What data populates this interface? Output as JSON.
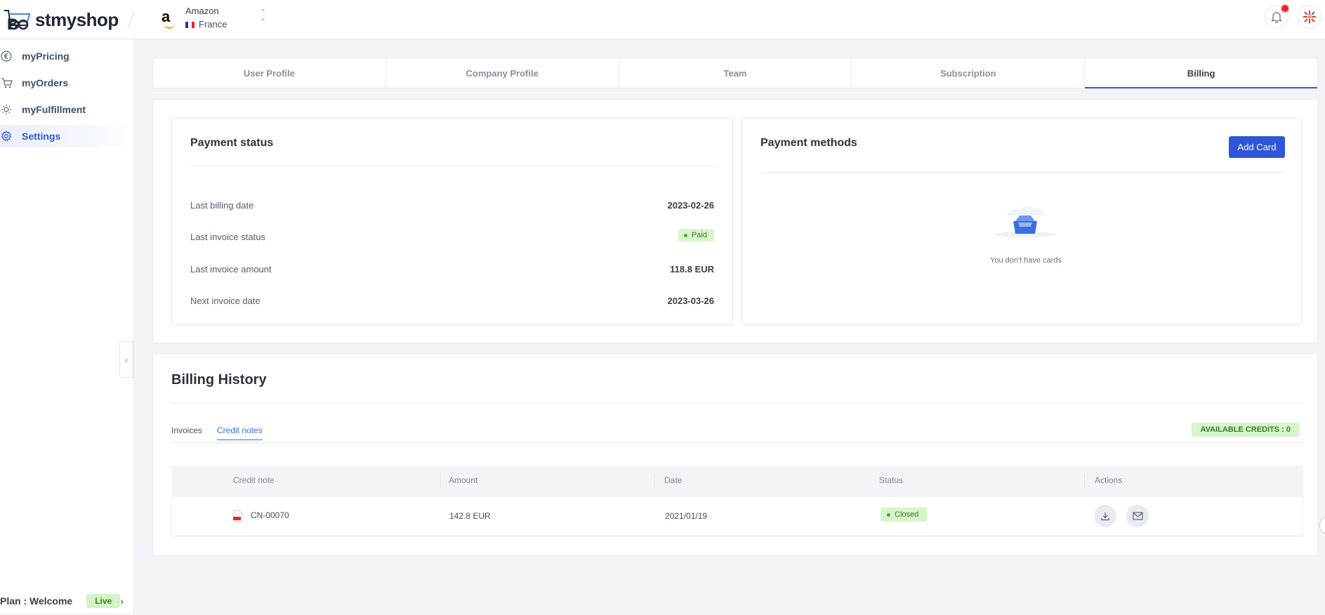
{
  "header": {
    "logo_text": "stmyshop",
    "store_name": "Amazon",
    "store_country": "France"
  },
  "sidebar": {
    "items": [
      {
        "label": "myPricing",
        "icon": "euro-circle-icon"
      },
      {
        "label": "myOrders",
        "icon": "cart-icon"
      },
      {
        "label": "myFulfillment",
        "icon": "sun-icon"
      },
      {
        "label": "Settings",
        "icon": "gear-icon"
      }
    ],
    "plan_label": "Plan : Welcome",
    "plan_badge": "Live"
  },
  "tabs": [
    "User Profile",
    "Company Profile",
    "Team",
    "Subscription",
    "Billing"
  ],
  "payment_status": {
    "title": "Payment status",
    "rows": [
      {
        "label": "Last billing date",
        "value": "2023-02-26"
      },
      {
        "label": "Last invoice status",
        "value": "Paid"
      },
      {
        "label": "Last invoice amount",
        "value": "118.8 EUR"
      },
      {
        "label": "Next invoice date",
        "value": "2023-03-26"
      }
    ]
  },
  "payment_methods": {
    "title": "Payment methods",
    "add_button": "Add Card",
    "empty_text": "You don't have cards"
  },
  "billing_history": {
    "title": "Billing History",
    "subtabs": [
      "Invoices",
      "Credit notes"
    ],
    "credits_badge": "AVAILABLE CREDITS : 0",
    "columns": [
      "Credit note",
      "Amount",
      "Date",
      "Status",
      "Actions"
    ],
    "rows": [
      {
        "credit_note": "CN-00070",
        "amount": "142.8 EUR",
        "date": "2021/01/19",
        "status": "Closed"
      }
    ]
  },
  "colors": {
    "accent": "#2f56d9",
    "success_bg": "#d6f5cb",
    "success_text": "#3b7a24"
  }
}
